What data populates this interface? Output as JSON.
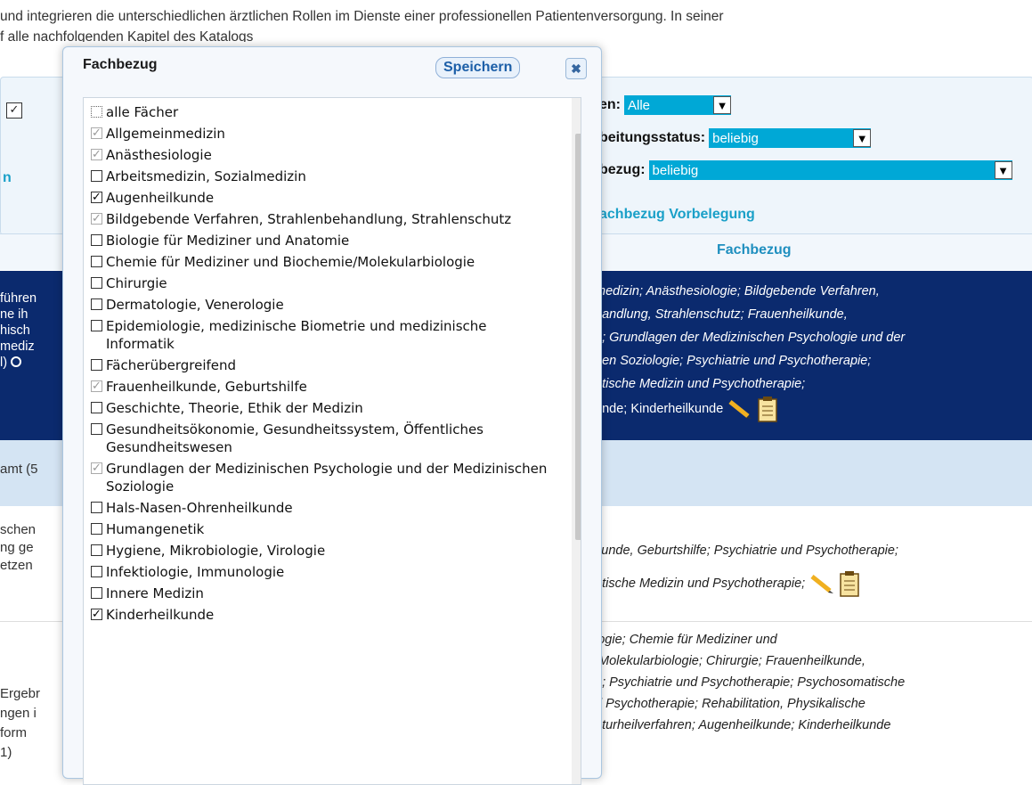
{
  "intro": {
    "line1": "und integrieren die unterschiedlichen ärztlichen Rollen im Dienste einer professionellen Patientenversorgung. In seiner",
    "line2": "f alle nachfolgenden Kapitel des Katalogs"
  },
  "filters": {
    "f1_label": "en:",
    "f1_value": "Alle",
    "f2_label": "beitungsstatus:",
    "f2_value": "beliebig",
    "f3_label": "bezug:",
    "f3_value": "beliebig",
    "preset_link": "achbezug Vorbelegung",
    "left_link": "n"
  },
  "table": {
    "header_col": "Fachbezug"
  },
  "rows": {
    "r1_left": [
      "führen",
      "ne ih",
      "hisch",
      "mediz",
      "l)"
    ],
    "r1_lines": [
      "medizin; Anästhesiologie; Bildgebende Verfahren,",
      "handlung, Strahlenschutz; Frauenheilkunde,",
      "e; Grundlagen der Medizinischen Psychologie und der",
      "hen Soziologie; Psychiatrie und Psychotherapie;",
      "atische Medizin und Psychotherapie;",
      "unde; Kinderheilkunde"
    ],
    "r2_left": "amt (5",
    "r3_left": [
      "schen",
      "ng ge",
      "etzen"
    ],
    "r3_lines": [
      "kunde, Geburtshilfe; Psychiatrie und Psychotherapie;",
      "atische Medizin und Psychotherapie;"
    ],
    "r4_left": [
      "Ergebr",
      "ngen i",
      "form",
      "1)"
    ],
    "r4_lines": [
      "logie; Chemie für Mediziner und",
      "/Molekularbiologie; Chirurgie; Frauenheilkunde,",
      "e; Psychiatrie und Psychotherapie; Psychosomatische",
      "d Psychotherapie; Rehabilitation, Physikalische",
      "aturheilverfahren; Augenheilkunde; Kinderheilkunde"
    ]
  },
  "modal": {
    "title": "Fachbezug",
    "save_label": "Speichern",
    "close_symbol": "✖",
    "items": [
      {
        "label": "alle Fächer",
        "state": "dotted"
      },
      {
        "label": "Allgemeinmedizin",
        "state": "gray"
      },
      {
        "label": "Anästhesiologie",
        "state": "gray"
      },
      {
        "label": "Arbeitsmedizin, Sozialmedizin",
        "state": "empty"
      },
      {
        "label": "Augenheilkunde",
        "state": "checked"
      },
      {
        "label": "Bildgebende Verfahren, Strahlenbehandlung, Strahlenschutz",
        "state": "gray"
      },
      {
        "label": "Biologie für Mediziner und Anatomie",
        "state": "empty"
      },
      {
        "label": "Chemie für Mediziner und Biochemie/Molekularbiologie",
        "state": "empty"
      },
      {
        "label": "Chirurgie",
        "state": "empty"
      },
      {
        "label": "Dermatologie, Venerologie",
        "state": "empty"
      },
      {
        "label": "Epidemiologie, medizinische Biometrie und medizinische Informatik",
        "state": "empty"
      },
      {
        "label": "Fächerübergreifend",
        "state": "empty"
      },
      {
        "label": "Frauenheilkunde, Geburtshilfe",
        "state": "gray"
      },
      {
        "label": "Geschichte, Theorie, Ethik der Medizin",
        "state": "empty"
      },
      {
        "label": "Gesundheitsökonomie, Gesundheitssystem, Öffentliches Gesundheitswesen",
        "state": "empty"
      },
      {
        "label": "Grundlagen der Medizinischen Psychologie und der Medizinischen Soziologie",
        "state": "gray"
      },
      {
        "label": "Hals-Nasen-Ohrenheilkunde",
        "state": "empty"
      },
      {
        "label": "Humangenetik",
        "state": "empty"
      },
      {
        "label": "Hygiene, Mikrobiologie, Virologie",
        "state": "empty"
      },
      {
        "label": "Infektiologie, Immunologie",
        "state": "empty"
      },
      {
        "label": "Innere Medizin",
        "state": "empty"
      },
      {
        "label": "Kinderheilkunde",
        "state": "checked"
      }
    ]
  }
}
